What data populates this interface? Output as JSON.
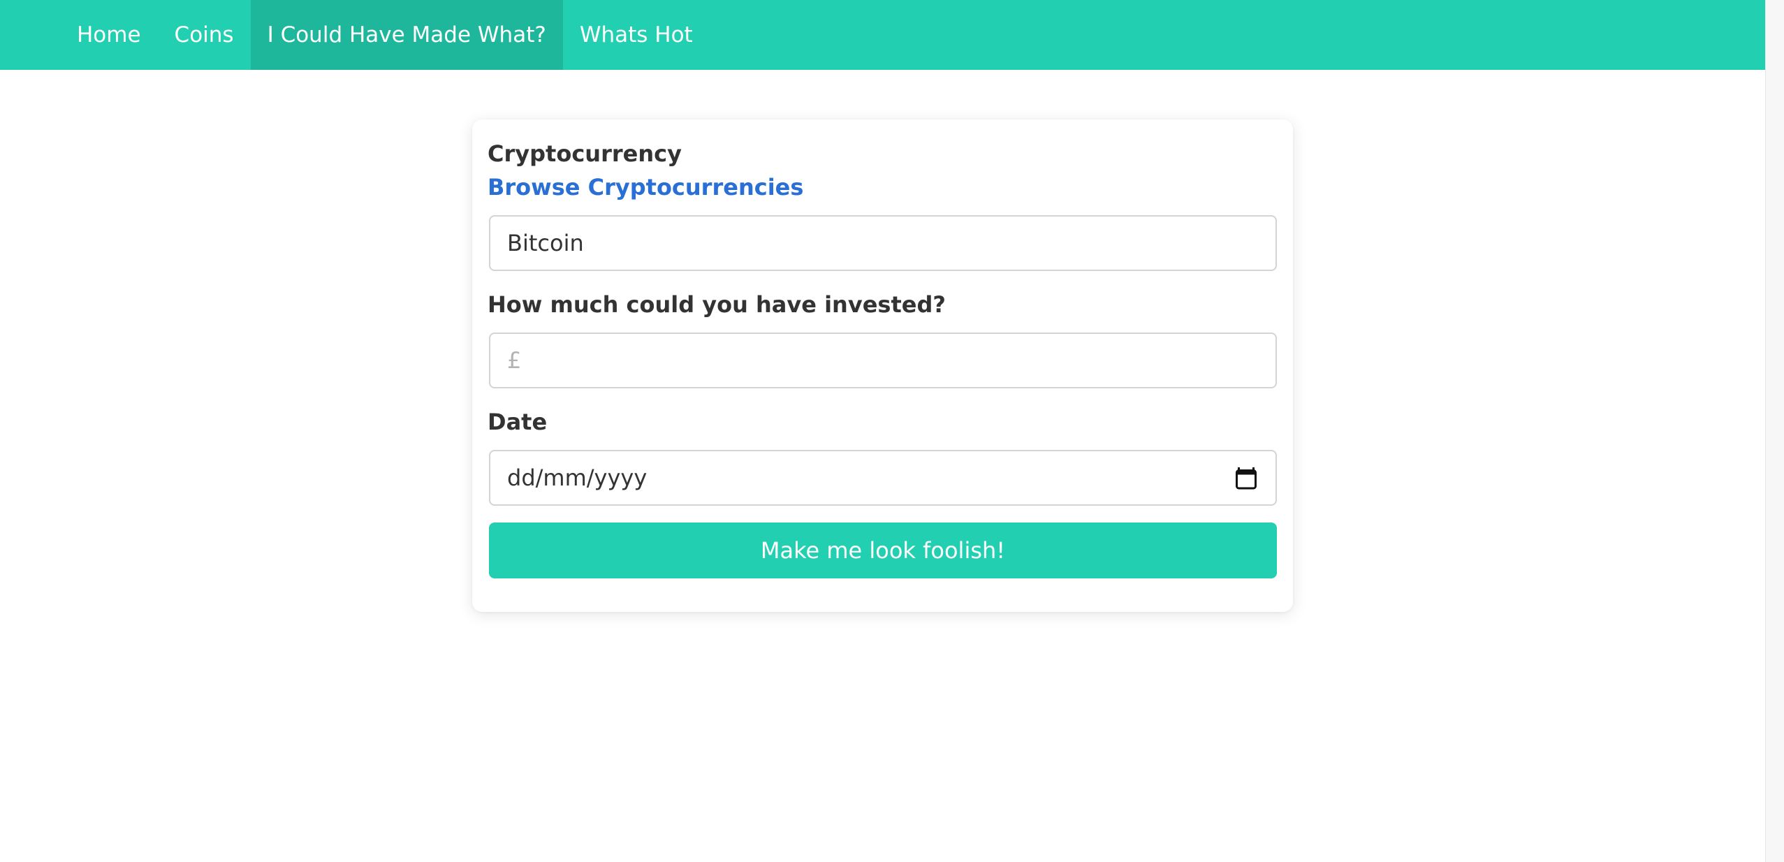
{
  "nav": {
    "items": [
      {
        "label": "Home"
      },
      {
        "label": "Coins"
      },
      {
        "label": "I Could Have Made What?"
      },
      {
        "label": "Whats Hot"
      }
    ],
    "active_index": 2,
    "color": "#22d0b1",
    "active_color": "#1fb79c"
  },
  "form": {
    "crypto_label": "Cryptocurrency",
    "browse_link": "Browse Cryptocurrencies",
    "crypto_value": "Bitcoin",
    "invest_label": "How much could you have invested?",
    "invest_placeholder": "£",
    "date_label": "Date",
    "date_placeholder": "dd/mm/yyyy",
    "date_icon": "calendar-icon",
    "submit_label": "Make me look foolish!",
    "link_color": "#2a6fd6"
  }
}
